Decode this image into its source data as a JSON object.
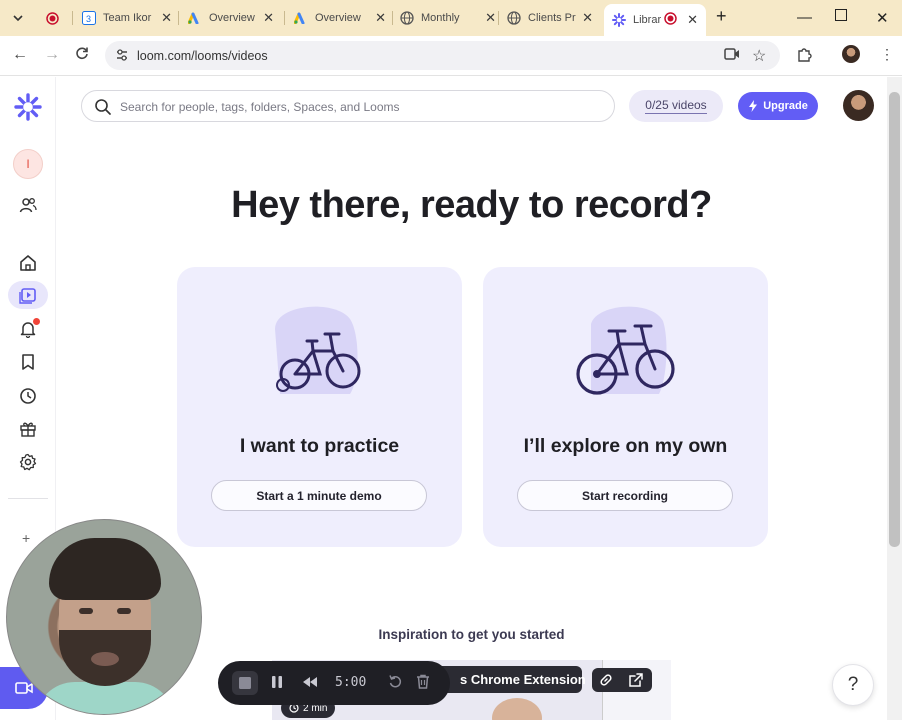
{
  "browser": {
    "tabs": [
      {
        "title": "",
        "icon": "recording-dot-icon"
      },
      {
        "title": "Team Ikor",
        "icon": "calendar-icon"
      },
      {
        "title": "Overview",
        "icon": "google-ads-icon"
      },
      {
        "title": "Overview",
        "icon": "google-ads-icon"
      },
      {
        "title": "Monthly",
        "icon": "globe-icon"
      },
      {
        "title": "Clients Pr",
        "icon": "globe-icon"
      },
      {
        "title": "Librar",
        "icon": "loom-icon",
        "active": true
      }
    ],
    "url": "loom.com/looms/videos"
  },
  "search": {
    "placeholder": "Search for people, tags, folders, Spaces, and Looms"
  },
  "header": {
    "video_count": "0/25 videos",
    "upgrade_label": "Upgrade"
  },
  "sidebar": {
    "workspace_initial": "I"
  },
  "main": {
    "title": "Hey there, ready to record?",
    "cards": [
      {
        "title": "I want to practice",
        "button": "Start a 1 minute demo"
      },
      {
        "title": "I’ll explore on my own",
        "button": "Start recording"
      }
    ],
    "inspiration_heading": "Inspiration to get you started",
    "thumbnail": {
      "title": "s Chrome Extension",
      "duration": "2 min"
    }
  },
  "recorder": {
    "timer": "5:00"
  },
  "help": {
    "label": "?"
  },
  "colors": {
    "accent": "#625df5",
    "card_bg": "#efeefd",
    "tabbar": "#f6e9c8",
    "notification": "#f04438"
  }
}
